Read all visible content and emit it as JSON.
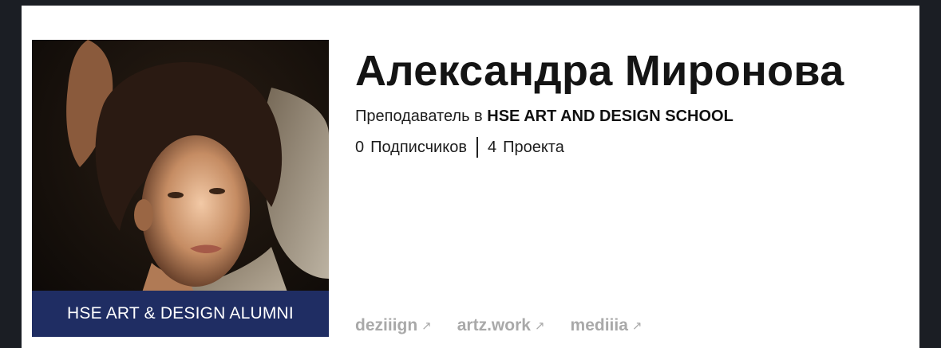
{
  "profile": {
    "name": "Александра Миронова",
    "role_prefix": "Преподаватель в",
    "role_org": "HSE ART AND DESIGN SCHOOL",
    "followers_count": "0",
    "followers_label": "Подписчиков",
    "projects_count": "4",
    "projects_label": "Проекта",
    "badge": "HSE ART & DESIGN ALUMNI"
  },
  "links": [
    {
      "label": "deziiign",
      "icon": "external-arrow-icon"
    },
    {
      "label": "artz.work",
      "icon": "external-arrow-icon"
    },
    {
      "label": "mediiia",
      "icon": "external-arrow-icon"
    }
  ],
  "colors": {
    "banner": "#1f2d63",
    "link": "#a9a9a9",
    "background": "#1b1e24"
  }
}
